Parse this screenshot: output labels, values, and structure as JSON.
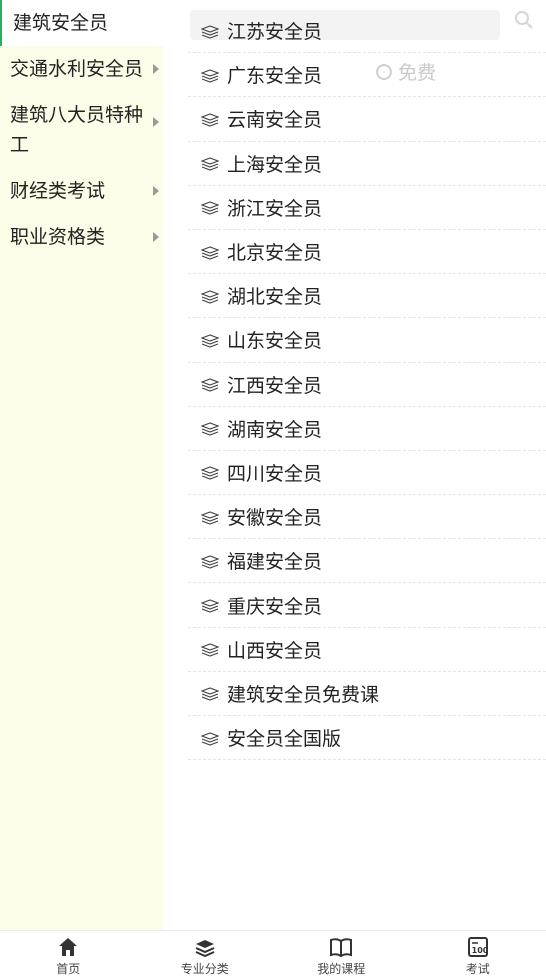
{
  "background": {
    "free_label": "免费"
  },
  "categories": [
    {
      "label": "建筑安全员",
      "active": true,
      "has_arrow": false
    },
    {
      "label": "交通水利安全员",
      "active": false,
      "has_arrow": true
    },
    {
      "label": "建筑八大员特种工",
      "active": false,
      "has_arrow": true
    },
    {
      "label": "财经类考试",
      "active": false,
      "has_arrow": true
    },
    {
      "label": "职业资格类",
      "active": false,
      "has_arrow": true
    }
  ],
  "subcategories": [
    {
      "label": "江苏安全员"
    },
    {
      "label": "广东安全员"
    },
    {
      "label": "云南安全员"
    },
    {
      "label": "上海安全员"
    },
    {
      "label": "浙江安全员"
    },
    {
      "label": "北京安全员"
    },
    {
      "label": "湖北安全员"
    },
    {
      "label": "山东安全员"
    },
    {
      "label": "江西安全员"
    },
    {
      "label": "湖南安全员"
    },
    {
      "label": "四川安全员"
    },
    {
      "label": "安徽安全员"
    },
    {
      "label": "福建安全员"
    },
    {
      "label": "重庆安全员"
    },
    {
      "label": "山西安全员"
    },
    {
      "label": "建筑安全员免费课"
    },
    {
      "label": "安全员全国版"
    }
  ],
  "tabbar": {
    "items": [
      {
        "label": "首页",
        "icon": "home-icon"
      },
      {
        "label": "专业分类",
        "icon": "books-icon"
      },
      {
        "label": "我的课程",
        "icon": "open-book-icon"
      },
      {
        "label": "考试",
        "icon": "exam-icon"
      }
    ]
  },
  "colors": {
    "accent": "#2dae5b",
    "sidebar_bg": "#fcfde8"
  }
}
